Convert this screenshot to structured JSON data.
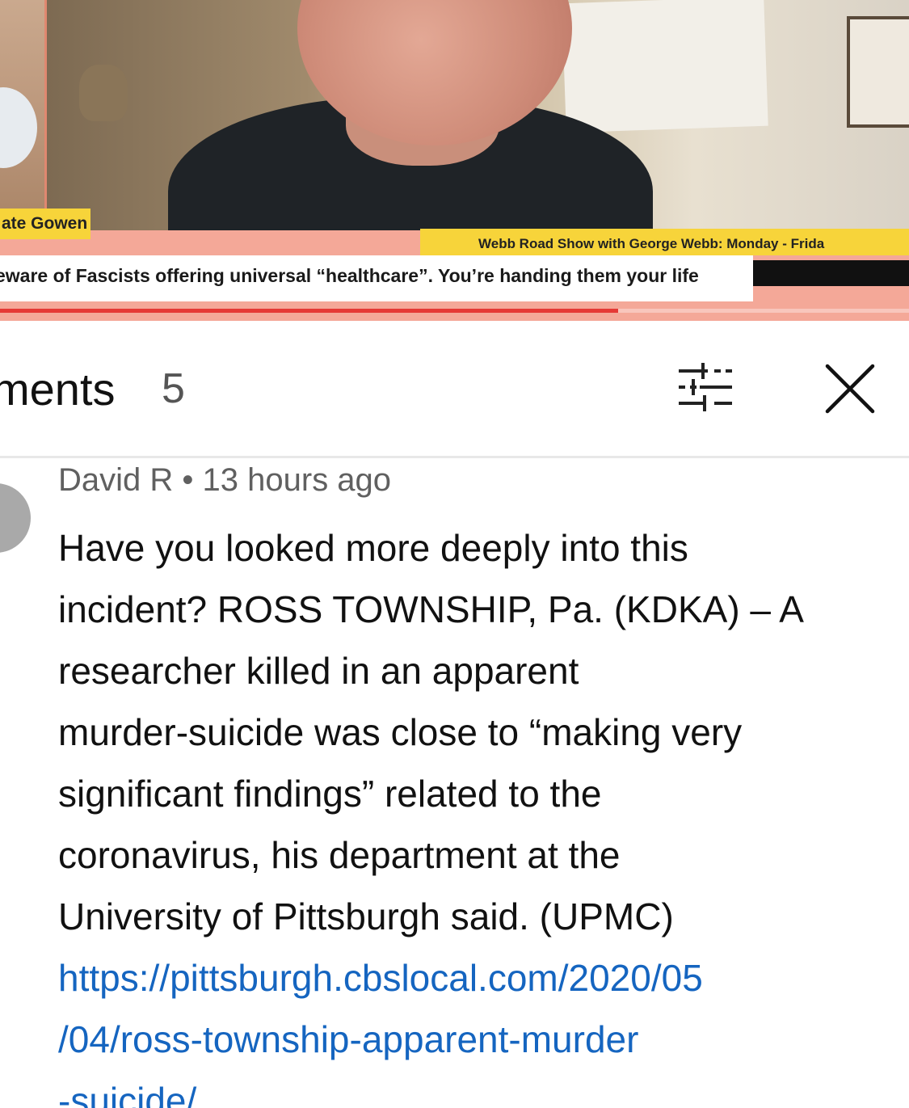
{
  "video": {
    "speaker_name": "ate Gowen",
    "ticker_top": "Webb Road Show with George Webb: Monday - Frida",
    "ticker_main": "eware of Fascists offering universal “healthcare”. You’re handing them your life",
    "progress_fraction": 0.68
  },
  "comments_panel": {
    "title": "ments",
    "count": "5",
    "filter_icon": "filter-sliders-icon",
    "close_icon": "close-icon"
  },
  "comment": {
    "author": "David R",
    "separator": "•",
    "time": "13 hours ago",
    "body_lines": [
      "Have you looked more deeply into this",
      "incident?  ROSS TOWNSHIP, Pa. (KDKA) – A",
      "researcher killed in an apparent",
      "murder-suicide was close to “making very",
      "significant findings” related to the",
      "coronavirus, his department at the",
      "University of Pittsburgh said. (UPMC)"
    ],
    "link_lines": [
      "https://pittsburgh.cbslocal.com/2020/05",
      "/04/ross-township-apparent-murder",
      "-suicide/"
    ]
  },
  "colors": {
    "ticker_yellow": "#f7d43a",
    "frame_salmon": "#f4a898",
    "progress_red": "#e53935",
    "link_blue": "#1565c0"
  }
}
